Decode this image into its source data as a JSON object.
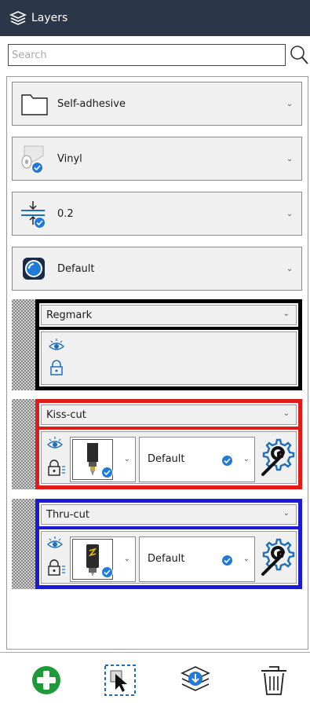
{
  "window": {
    "title": "Layers"
  },
  "search": {
    "placeholder": "Search"
  },
  "dropdowns": {
    "material": {
      "label": "Self-adhesive",
      "icon": "folder-icon"
    },
    "media": {
      "label": "Vinyl",
      "icon": "vinyl-roll-icon"
    },
    "thickness": {
      "label": "0.2",
      "icon": "thickness-icon"
    },
    "preset": {
      "label": "Default",
      "icon": "preset-icon"
    }
  },
  "layers": [
    {
      "name": "Regmark",
      "color": "#000000"
    },
    {
      "name": "Kiss-cut",
      "color": "#e11a1a",
      "toolset": "Default"
    },
    {
      "name": "Thru-cut",
      "color": "#1a1ad8",
      "toolset": "Default"
    }
  ],
  "colors": {
    "titlebar": "#2b3748",
    "accent_blue": "#1f7ad8",
    "add_green": "#1f9a3a",
    "icon_blue": "#1f6fb8"
  },
  "footer": {
    "add": "add-layer-icon",
    "select": "select-objects-icon",
    "merge": "merge-layers-icon",
    "delete": "trash-icon"
  }
}
